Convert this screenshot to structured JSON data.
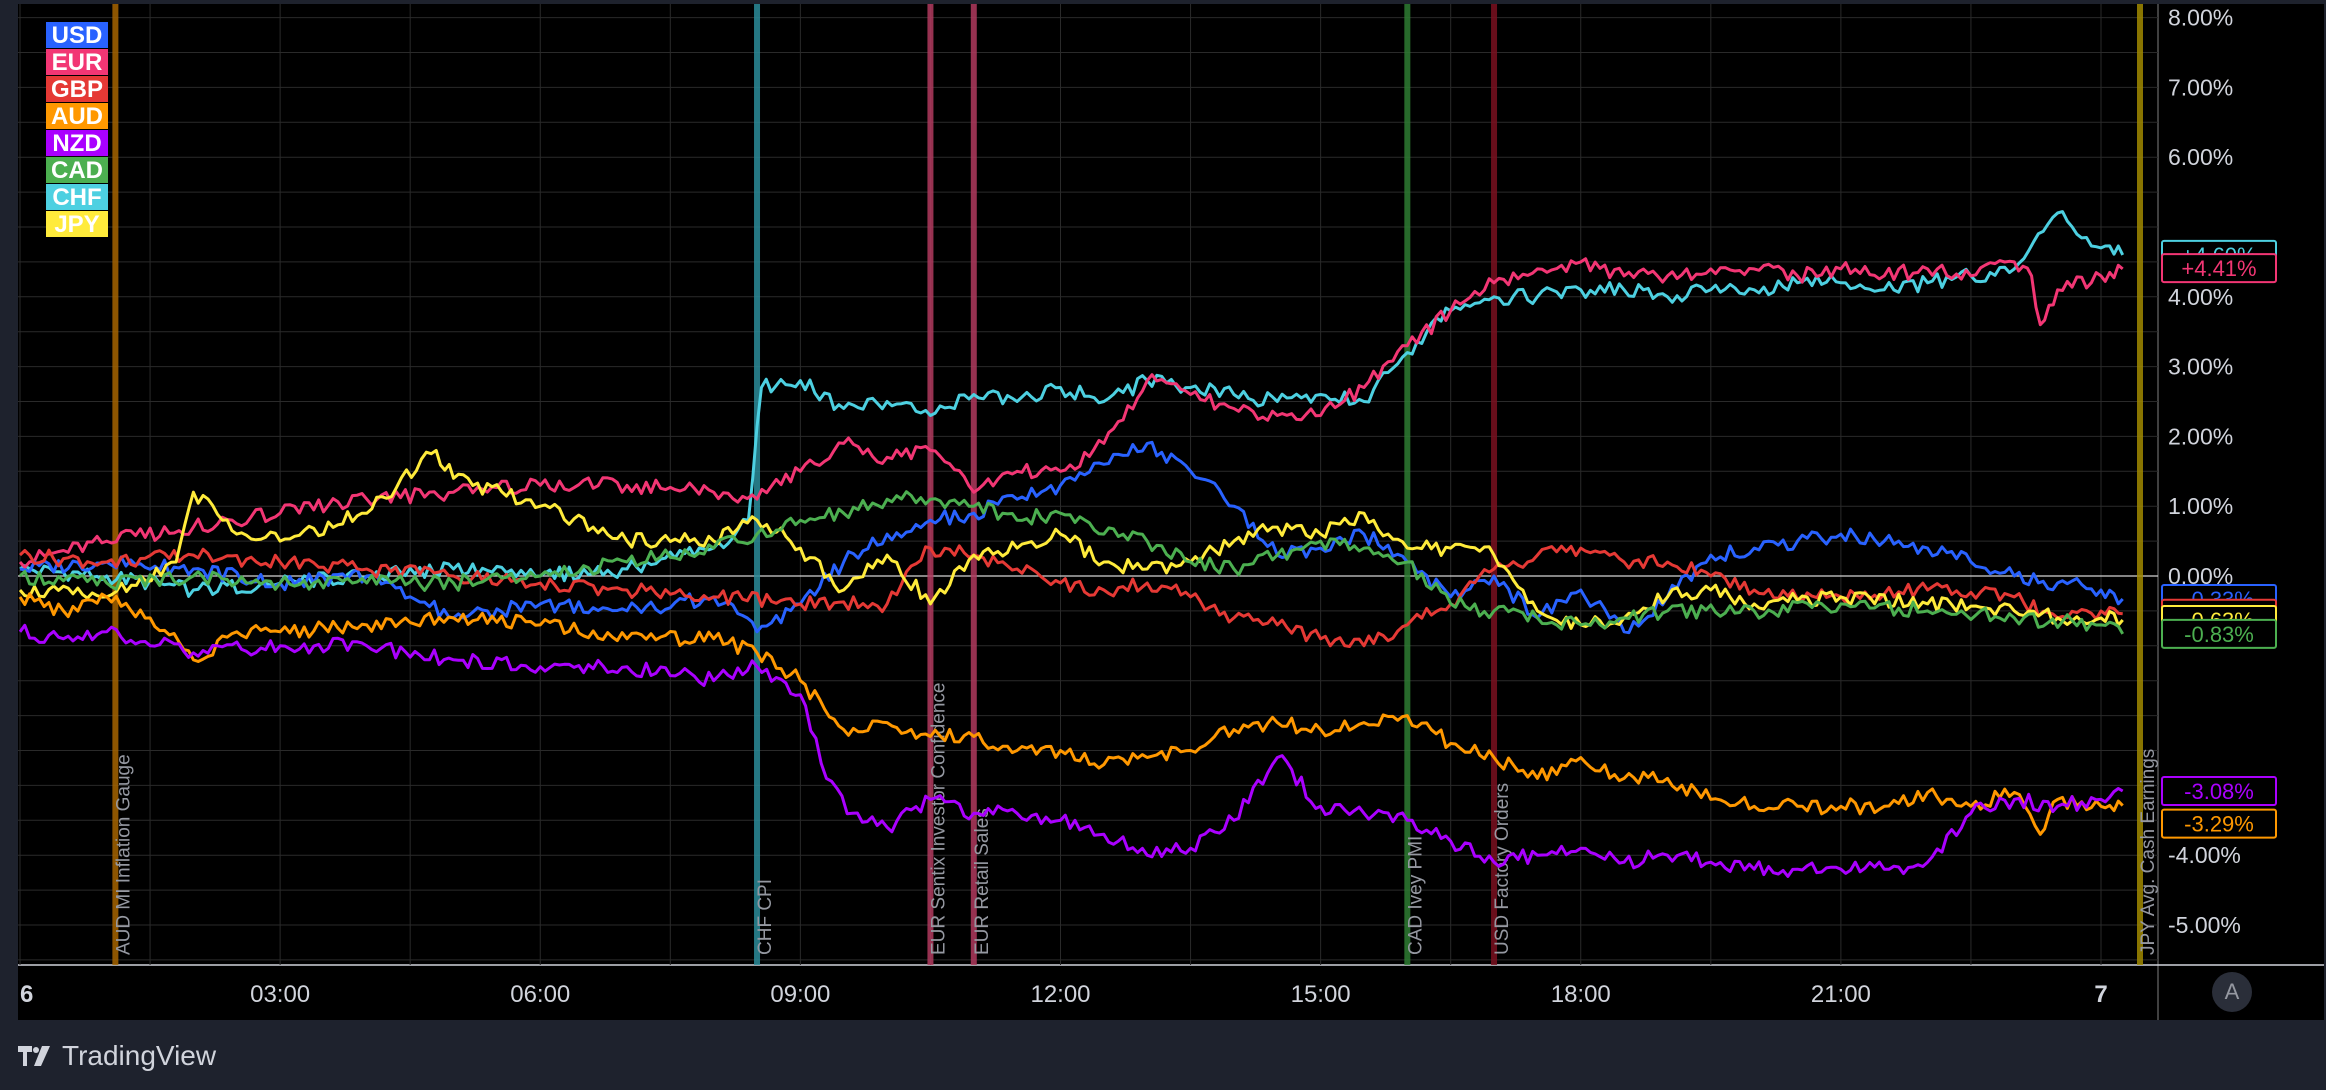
{
  "footer": {
    "brand": "TradingView",
    "auto_label": "A"
  },
  "colors": {
    "background": "#000000",
    "frame": "#1e222d",
    "grid": "#2a2a2a",
    "axis_text": "#d1d4dc",
    "zero_line": "#ffffff"
  },
  "chart_data": {
    "type": "line",
    "title": "",
    "xlabel": "",
    "ylabel": "",
    "x_unit": "hours from 00:00 (day 6)",
    "xlim": [
      -1,
      24.25
    ],
    "ylim": [
      -5.5,
      8.2
    ],
    "y_ticks": [
      8,
      7,
      6,
      4,
      3,
      2,
      1,
      0,
      -4,
      -5
    ],
    "y_tick_labels": [
      "8.00%",
      "7.00%",
      "6.00%",
      "4.00%",
      "3.00%",
      "2.00%",
      "1.00%",
      "0.00%",
      "-4.00%",
      "-5.00%"
    ],
    "x_ticks": [
      0,
      3,
      6,
      9,
      12,
      15,
      18,
      21,
      24
    ],
    "x_tick_labels": [
      "6",
      "03:00",
      "06:00",
      "09:00",
      "12:00",
      "15:00",
      "18:00",
      "21:00",
      "7"
    ],
    "grid": true,
    "legend_position": "top-left",
    "legend": [
      {
        "label": "USD",
        "color": "#2962ff"
      },
      {
        "label": "EUR",
        "color": "#f23674"
      },
      {
        "label": "GBP",
        "color": "#e53935"
      },
      {
        "label": "AUD",
        "color": "#ff9800"
      },
      {
        "label": "NZD",
        "color": "#aa00ff"
      },
      {
        "label": "CAD",
        "color": "#4caf50"
      },
      {
        "label": "CHF",
        "color": "#4dd0e1"
      },
      {
        "label": "JPY",
        "color": "#ffeb3b"
      }
    ],
    "events": [
      {
        "x": 1.1,
        "label": "AUD MI Inflation Gauge",
        "color": "#a66400"
      },
      {
        "x": 8.5,
        "label": "CHF CPI",
        "color": "#2b8c9a"
      },
      {
        "x": 10.5,
        "label": "EUR Sentix Investor Confidence",
        "color": "#b03a5e"
      },
      {
        "x": 11.0,
        "label": "EUR Retail Sales",
        "color": "#b03a5e"
      },
      {
        "x": 16.0,
        "label": "CAD Ivey PMI",
        "color": "#2e7d32"
      },
      {
        "x": 17.0,
        "label": "USD Factory Orders",
        "color": "#7a1020"
      },
      {
        "x": 24.5,
        "label": "JPY Avg. Cash Earnings",
        "color": "#a18a00"
      }
    ],
    "series": [
      {
        "name": "CHF",
        "color": "#4dd0e1",
        "last": "+4.60%",
        "last_value": 4.6,
        "x": [
          0,
          1,
          2,
          3,
          4,
          5,
          6,
          7,
          8,
          8.4,
          8.55,
          9,
          9.5,
          10,
          10.5,
          11,
          11.5,
          12,
          12.5,
          13,
          13.5,
          14,
          14.5,
          15,
          15.5,
          16,
          16.5,
          17,
          17.5,
          18,
          18.5,
          19,
          19.5,
          20,
          20.5,
          21,
          21.5,
          22,
          22.5,
          23,
          23.5,
          24,
          24.25
        ],
        "y": [
          0.1,
          0.0,
          -0.2,
          -0.1,
          0.0,
          0.1,
          0.0,
          0.1,
          0.4,
          0.8,
          2.7,
          2.8,
          2.4,
          2.5,
          2.3,
          2.6,
          2.5,
          2.7,
          2.5,
          2.8,
          2.7,
          2.6,
          2.5,
          2.6,
          2.5,
          3.2,
          3.8,
          4.0,
          4.0,
          4.1,
          4.1,
          4.0,
          4.1,
          4.1,
          4.2,
          4.2,
          4.1,
          4.2,
          4.3,
          4.4,
          5.2,
          4.7,
          4.6
        ]
      },
      {
        "name": "EUR",
        "color": "#f23674",
        "last": "+4.41%",
        "last_value": 4.41,
        "x": [
          0,
          1,
          2,
          3,
          4,
          5,
          6,
          7,
          8,
          8.5,
          9,
          9.5,
          10,
          10.5,
          11,
          11.5,
          12,
          12.5,
          13,
          13.5,
          14,
          14.5,
          15,
          15.5,
          16,
          16.5,
          17,
          17.5,
          18,
          18.5,
          19,
          19.5,
          20,
          20.5,
          21,
          21.5,
          22,
          22.5,
          23,
          23.2,
          23.3,
          23.5,
          24,
          24.25
        ],
        "y": [
          0.2,
          0.5,
          0.7,
          0.9,
          1.1,
          1.2,
          1.3,
          1.3,
          1.2,
          1.1,
          1.5,
          1.9,
          1.7,
          1.8,
          1.2,
          1.5,
          1.5,
          1.9,
          2.8,
          2.6,
          2.4,
          2.3,
          2.3,
          2.7,
          3.3,
          3.8,
          4.2,
          4.4,
          4.5,
          4.3,
          4.3,
          4.4,
          4.4,
          4.3,
          4.4,
          4.3,
          4.4,
          4.3,
          4.5,
          4.3,
          3.6,
          4.1,
          4.3,
          4.4
        ]
      },
      {
        "name": "USD",
        "color": "#2962ff",
        "last": "-0.33%",
        "last_value": -0.33,
        "x": [
          0,
          1,
          2,
          3,
          4,
          5,
          6,
          7,
          8,
          8.5,
          9,
          9.5,
          10,
          10.5,
          11,
          11.5,
          12,
          12.5,
          13,
          13.5,
          14,
          14.5,
          15,
          15.5,
          16,
          16.5,
          17,
          17.5,
          18,
          18.5,
          19,
          19.5,
          20,
          20.5,
          21,
          21.5,
          22,
          22.5,
          23,
          23.5,
          24,
          24.25
        ],
        "y": [
          0.1,
          0.2,
          0.1,
          -0.1,
          0.0,
          -0.6,
          -0.4,
          -0.5,
          -0.3,
          -0.8,
          -0.4,
          0.2,
          0.6,
          0.8,
          0.9,
          1.1,
          1.3,
          1.6,
          1.9,
          1.5,
          1.0,
          0.3,
          0.4,
          0.6,
          0.2,
          -0.3,
          0.0,
          -0.6,
          -0.2,
          -0.8,
          -0.3,
          0.3,
          0.4,
          0.5,
          0.6,
          0.5,
          0.4,
          0.2,
          0.0,
          -0.1,
          -0.2,
          -0.33
        ]
      },
      {
        "name": "GBP",
        "color": "#e53935",
        "last": "-0.54%",
        "last_value": -0.54,
        "x": [
          0,
          1,
          2,
          3,
          4,
          5,
          6,
          7,
          8,
          9,
          10,
          10.5,
          11,
          11.5,
          12,
          12.5,
          13,
          13.5,
          14,
          14.5,
          15,
          15.5,
          16,
          16.5,
          17,
          17.5,
          18,
          18.5,
          19,
          19.5,
          20,
          21,
          22,
          23,
          23.5,
          24,
          24.25
        ],
        "y": [
          0.3,
          0.2,
          0.3,
          0.2,
          0.1,
          0.0,
          -0.1,
          -0.2,
          -0.3,
          -0.4,
          -0.4,
          0.4,
          0.3,
          0.1,
          -0.1,
          -0.2,
          -0.1,
          -0.3,
          -0.6,
          -0.7,
          -0.9,
          -1.0,
          -0.7,
          -0.4,
          0.1,
          0.3,
          0.4,
          0.2,
          0.2,
          0.0,
          -0.2,
          -0.3,
          -0.2,
          -0.3,
          -0.6,
          -0.5,
          -0.54
        ]
      },
      {
        "name": "JPY",
        "color": "#ffeb3b",
        "last": "-0.63%",
        "last_value": -0.63,
        "x": [
          0,
          1,
          1.8,
          2,
          2.5,
          3,
          4,
          4.8,
          5,
          6,
          7,
          8,
          8.5,
          9,
          9.5,
          10,
          10.5,
          11,
          11.5,
          12,
          12.5,
          13,
          13.5,
          14,
          14.5,
          15,
          15.5,
          16,
          16.5,
          17,
          17.5,
          18,
          18.5,
          19,
          19.5,
          20,
          21,
          22,
          23,
          23.5,
          24,
          24.25
        ],
        "y": [
          -0.2,
          -0.3,
          0.2,
          1.2,
          0.6,
          0.5,
          0.9,
          1.8,
          1.4,
          1.0,
          0.5,
          0.5,
          0.8,
          0.4,
          -0.2,
          0.3,
          -0.4,
          0.3,
          0.4,
          0.6,
          0.2,
          0.1,
          0.2,
          0.5,
          0.7,
          0.6,
          0.9,
          0.4,
          0.4,
          0.3,
          -0.5,
          -0.7,
          -0.6,
          -0.3,
          -0.2,
          -0.4,
          -0.3,
          -0.4,
          -0.5,
          -0.6,
          -0.6,
          -0.63
        ]
      },
      {
        "name": "CAD",
        "color": "#4caf50",
        "last": "-0.83%",
        "last_value": -0.83,
        "x": [
          0,
          1,
          2,
          3,
          4,
          5,
          6,
          7,
          8,
          8.5,
          9,
          9.5,
          10,
          10.5,
          11,
          11.5,
          12,
          12.5,
          13,
          13.5,
          14,
          14.5,
          15,
          15.5,
          16,
          16.5,
          17,
          17.5,
          18,
          18.5,
          19,
          20,
          21,
          22,
          23,
          24,
          24.25
        ],
        "y": [
          0.0,
          -0.1,
          0.0,
          -0.1,
          -0.1,
          -0.1,
          0.0,
          0.2,
          0.4,
          0.6,
          0.8,
          0.9,
          1.1,
          1.1,
          1.0,
          0.8,
          0.9,
          0.6,
          0.5,
          0.2,
          0.1,
          0.3,
          0.5,
          0.4,
          0.2,
          -0.4,
          -0.5,
          -0.6,
          -0.7,
          -0.6,
          -0.5,
          -0.5,
          -0.4,
          -0.5,
          -0.6,
          -0.7,
          -0.83
        ]
      },
      {
        "name": "AUD",
        "color": "#ff9800",
        "last": "-3.29%",
        "last_value": -3.29,
        "x": [
          0,
          0.5,
          1,
          1.5,
          2,
          2.5,
          3,
          4,
          5,
          6,
          7,
          8,
          8.5,
          9,
          9.5,
          10,
          10.5,
          11,
          11.5,
          12,
          12.5,
          13,
          13.5,
          14,
          14.5,
          15,
          15.5,
          16,
          16.5,
          17,
          17.5,
          18,
          18.5,
          19,
          19.5,
          20,
          20.5,
          21,
          21.5,
          22,
          22.5,
          23,
          23.3,
          23.5,
          24,
          24.25
        ],
        "y": [
          -0.3,
          -0.5,
          -0.3,
          -0.6,
          -1.2,
          -0.8,
          -0.8,
          -0.7,
          -0.6,
          -0.7,
          -0.9,
          -0.9,
          -1.1,
          -1.5,
          -2.2,
          -2.1,
          -2.3,
          -2.3,
          -2.5,
          -2.5,
          -2.7,
          -2.6,
          -2.5,
          -2.2,
          -2.1,
          -2.2,
          -2.1,
          -2.0,
          -2.4,
          -2.6,
          -2.9,
          -2.6,
          -2.9,
          -2.9,
          -3.2,
          -3.3,
          -3.3,
          -3.3,
          -3.3,
          -3.1,
          -3.3,
          -3.1,
          -3.7,
          -3.2,
          -3.3,
          -3.29
        ]
      },
      {
        "name": "NZD",
        "color": "#aa00ff",
        "last": "-3.08%",
        "last_value": -3.08,
        "x": [
          0,
          0.5,
          1,
          2,
          3,
          4,
          5,
          6,
          7,
          8,
          8.5,
          9,
          9.3,
          9.6,
          10,
          10.5,
          11,
          11.5,
          12,
          12.5,
          13,
          13.5,
          14,
          14.5,
          15,
          15.5,
          16,
          16.5,
          17,
          17.5,
          18,
          18.5,
          19,
          19.5,
          20,
          20.5,
          21,
          21.5,
          22,
          22.5,
          23,
          23.5,
          24,
          24.25
        ],
        "y": [
          -0.8,
          -0.9,
          -0.8,
          -1.1,
          -1.0,
          -1.0,
          -1.2,
          -1.3,
          -1.3,
          -1.5,
          -1.3,
          -1.7,
          -2.9,
          -3.4,
          -3.6,
          -3.2,
          -3.4,
          -3.4,
          -3.5,
          -3.7,
          -4.0,
          -3.9,
          -3.5,
          -2.6,
          -3.3,
          -3.4,
          -3.5,
          -3.8,
          -4.1,
          -4.0,
          -3.9,
          -4.1,
          -4.0,
          -4.1,
          -4.2,
          -4.2,
          -4.2,
          -4.2,
          -4.1,
          -3.4,
          -3.2,
          -3.3,
          -3.2,
          -3.08
        ]
      }
    ]
  }
}
